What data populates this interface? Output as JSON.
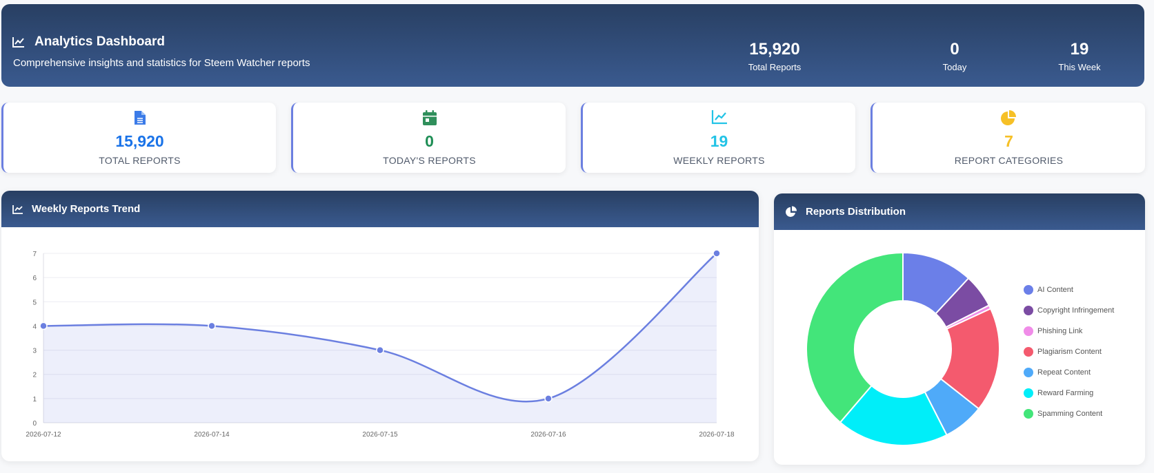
{
  "header": {
    "title": "Analytics Dashboard",
    "subtitle": "Comprehensive insights and statistics for Steem Watcher reports",
    "stats": [
      {
        "value": "15,920",
        "label": "Total Reports"
      },
      {
        "value": "0",
        "label": "Today"
      },
      {
        "value": "19",
        "label": "This Week"
      }
    ]
  },
  "cards": [
    {
      "value": "15,920",
      "label": "TOTAL REPORTS",
      "icon": "document-icon",
      "color": "#1a73e8"
    },
    {
      "value": "0",
      "label": "TODAY'S REPORTS",
      "icon": "calendar-icon",
      "color": "#1e8e55"
    },
    {
      "value": "19",
      "label": "WEEKLY REPORTS",
      "icon": "line-chart-icon",
      "color": "#22c3e6"
    },
    {
      "value": "7",
      "label": "REPORT CATEGORIES",
      "icon": "pie-chart-icon",
      "color": "#f6c026"
    }
  ],
  "trend_panel": {
    "title": "Weekly Reports Trend"
  },
  "distribution_panel": {
    "title": "Reports Distribution"
  },
  "chart_data": [
    {
      "type": "line",
      "x": [
        "2026-07-12",
        "2026-07-14",
        "2026-07-15",
        "2026-07-16",
        "2026-07-18"
      ],
      "values": [
        4,
        4,
        3,
        1,
        7
      ],
      "ylim": [
        0,
        7
      ],
      "yticks": [
        0,
        1,
        2,
        3,
        4,
        5,
        6,
        7
      ],
      "grid": true,
      "color": "#6b7fe0"
    },
    {
      "type": "pie",
      "donut": true,
      "legend_position": "right",
      "slices": [
        {
          "name": "AI Content",
          "value": 1.9,
          "color": "#6b7fe8"
        },
        {
          "name": "Copyright Infringement",
          "value": 0.9,
          "color": "#7b4ca3"
        },
        {
          "name": "Phishing Link",
          "value": 0.1,
          "color": "#f08ce8"
        },
        {
          "name": "Plagiarism Content",
          "value": 2.8,
          "color": "#f45a6e"
        },
        {
          "name": "Repeat Content",
          "value": 1.1,
          "color": "#4faaf9"
        },
        {
          "name": "Reward Farming",
          "value": 3.0,
          "color": "#00eef9"
        },
        {
          "name": "Spamming Content",
          "value": 6.2,
          "color": "#43e57a"
        }
      ]
    }
  ]
}
